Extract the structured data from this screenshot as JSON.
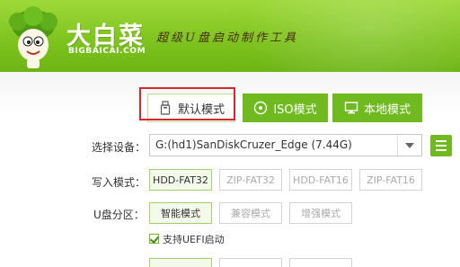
{
  "header": {
    "brand_name": "大白菜",
    "brand_domain": "BIGBAICAI.COM",
    "slogan": "超级U盘启动制作工具"
  },
  "tabs": [
    {
      "label": "默认模式",
      "icon": "usb-drive-icon",
      "active": true
    },
    {
      "label": "ISO模式",
      "icon": "disc-icon",
      "active": false
    },
    {
      "label": "本地模式",
      "icon": "monitor-icon",
      "active": false
    }
  ],
  "device": {
    "label": "选择设备：",
    "value": "G:(hd1)SanDiskCruzer_Edge (7.44G)"
  },
  "write_mode": {
    "label": "写入模式：",
    "options": [
      "HDD-FAT32",
      "ZIP-FAT32",
      "HDD-FAT16",
      "ZIP-FAT16"
    ],
    "selected": "HDD-FAT32"
  },
  "partition": {
    "label": "U盘分区：",
    "options": [
      "智能模式",
      "兼容模式",
      "增强模式"
    ],
    "selected": "智能模式"
  },
  "uefi": {
    "label": "支持UEFI启动",
    "checked": true
  },
  "colors": {
    "accent_green": "#6fba1f",
    "highlight_red": "#d8262c"
  }
}
